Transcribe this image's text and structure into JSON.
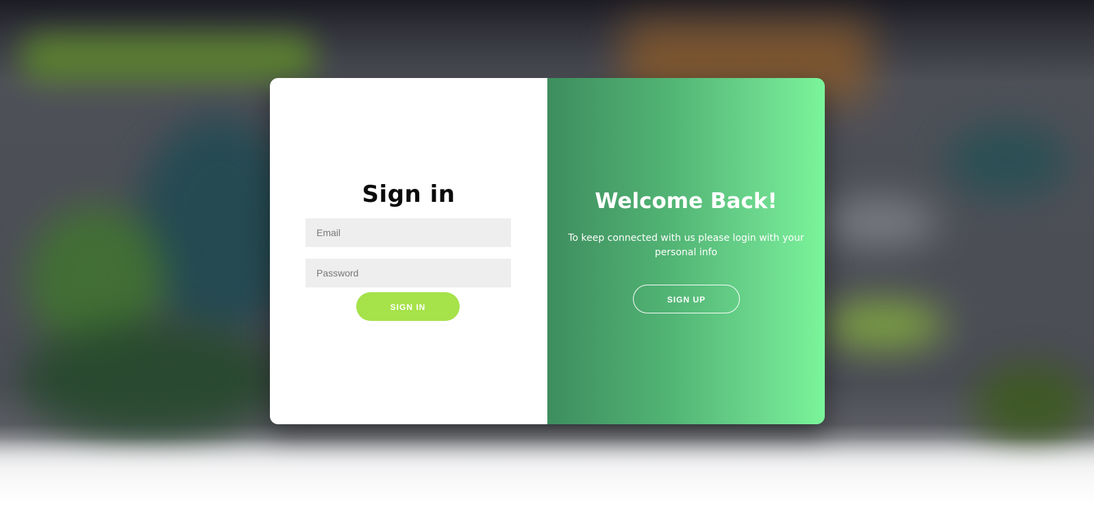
{
  "signin": {
    "title": "Sign in",
    "email_placeholder": "Email",
    "password_placeholder": "Password",
    "button_label": "SIGN IN"
  },
  "welcome": {
    "title": "Welcome Back!",
    "text": "To keep connected with us please login with your personal info",
    "button_label": "SIGN UP"
  },
  "colors": {
    "accent_green": "#a6e24a",
    "panel_gradient_start": "#3e8d5e",
    "panel_gradient_end": "#7af59a"
  }
}
